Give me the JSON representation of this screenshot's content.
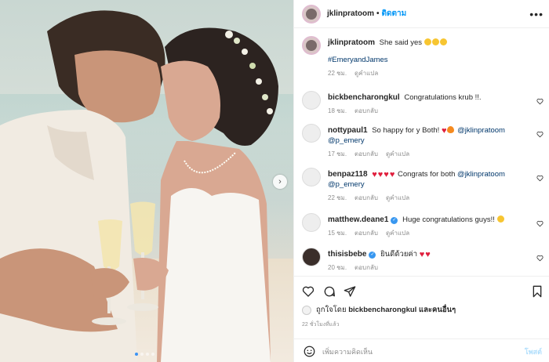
{
  "post": {
    "author": "jklinpratoom",
    "follow_label": "ติดตาม",
    "separator": "•",
    "more_label": "•••",
    "caption": {
      "text": "She said yes",
      "hashtag": "#EmeryandJames",
      "time": "22 ชม.",
      "translate": "ดูคำแปล"
    },
    "photo": {
      "carousel_pages": 4,
      "active_page": 1
    }
  },
  "comments": [
    {
      "username": "bickbencharongkul",
      "text": "Congratulations krub !!.",
      "time": "18 ชม.",
      "reply": "ตอบกลับ",
      "translate": ""
    },
    {
      "username": "nottypaul1",
      "text_before": "So happy for y Both!",
      "mention1": "@jklinpratoom",
      "mention2": "@p_emery",
      "time": "17 ชม.",
      "reply": "ตอบกลับ",
      "translate": "ดูคำแปล"
    },
    {
      "username": "benpaz118",
      "text_before": "Congrats for both",
      "mention1": "@jklinpratoom",
      "mention2": "@p_emery",
      "time": "22 ชม.",
      "reply": "ตอบกลับ",
      "translate": "ดูคำแปล"
    },
    {
      "username": "matthew.deane1",
      "text": "Huge congratulations guys!!",
      "time": "15 ชม.",
      "reply": "ตอบกลับ",
      "translate": "ดูคำแปล"
    },
    {
      "username": "thisisbebe",
      "text": "ยินดีด้วยค่า",
      "time": "20 ชม.",
      "reply": "ตอบกลับ",
      "translate": ""
    }
  ],
  "likes": {
    "prefix": "ถูกใจโดย",
    "user": "bickbencharongkul",
    "suffix": "และคนอื่นๆ",
    "time_ago": "22 ชั่วโมงที่แล้ว"
  },
  "add_comment": {
    "placeholder": "เพิ่มความคิดเห็น",
    "post_label": "โพสต์"
  },
  "colors": {
    "accent": "#0095f6",
    "link": "#00376b",
    "muted": "#8e8e8e",
    "heart": "#e01f3d",
    "verified": "#3897f0"
  },
  "icons": [
    "heart-icon",
    "comment-icon",
    "share-icon",
    "bookmark-icon",
    "emoji-icon",
    "next-arrow-icon",
    "more-icon"
  ]
}
